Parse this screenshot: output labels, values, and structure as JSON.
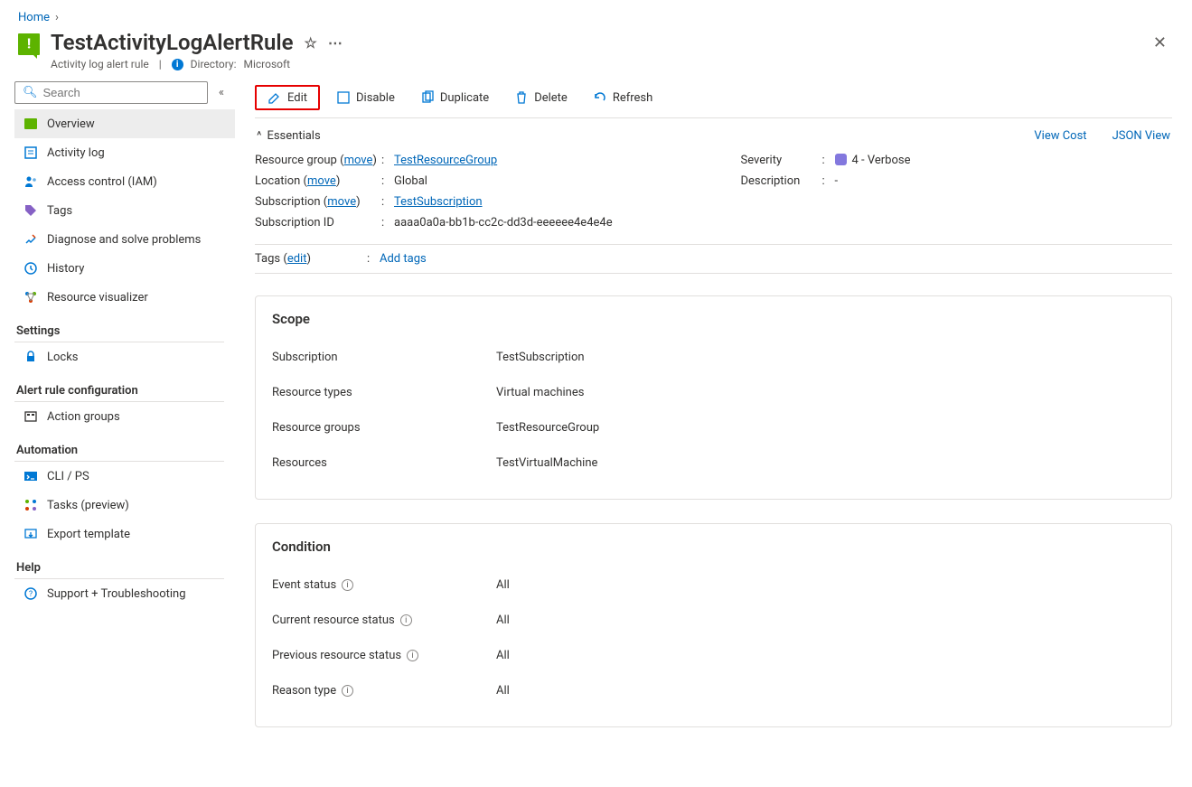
{
  "breadcrumb": {
    "home": "Home"
  },
  "header": {
    "title": "TestActivityLogAlertRule",
    "subtitle": "Activity log alert rule",
    "directory_label": "Directory:",
    "directory_value": "Microsoft"
  },
  "search": {
    "placeholder": "Search"
  },
  "sidebar": {
    "items": [
      {
        "label": "Overview"
      },
      {
        "label": "Activity log"
      },
      {
        "label": "Access control (IAM)"
      },
      {
        "label": "Tags"
      },
      {
        "label": "Diagnose and solve problems"
      },
      {
        "label": "History"
      },
      {
        "label": "Resource visualizer"
      }
    ],
    "section_settings": "Settings",
    "settings_items": [
      {
        "label": "Locks"
      }
    ],
    "section_rule": "Alert rule configuration",
    "rule_items": [
      {
        "label": "Action groups"
      }
    ],
    "section_automation": "Automation",
    "automation_items": [
      {
        "label": "CLI / PS"
      },
      {
        "label": "Tasks (preview)"
      },
      {
        "label": "Export template"
      }
    ],
    "section_help": "Help",
    "help_items": [
      {
        "label": "Support + Troubleshooting"
      }
    ]
  },
  "toolbar": {
    "edit": "Edit",
    "disable": "Disable",
    "duplicate": "Duplicate",
    "delete": "Delete",
    "refresh": "Refresh"
  },
  "essentials": {
    "toggle_label": "Essentials",
    "view_cost": "View Cost",
    "json_view": "JSON View",
    "left": {
      "resource_group_label": "Resource group",
      "resource_group_value": "TestResourceGroup",
      "location_label": "Location",
      "location_value": "Global",
      "subscription_label": "Subscription",
      "subscription_value": "TestSubscription",
      "subscription_id_label": "Subscription ID",
      "subscription_id_value": "aaaa0a0a-bb1b-cc2c-dd3d-eeeeee4e4e4e",
      "move": "move"
    },
    "right": {
      "severity_label": "Severity",
      "severity_value": "4 - Verbose",
      "description_label": "Description",
      "description_value": "-"
    }
  },
  "tags": {
    "label": "Tags",
    "edit": "edit",
    "add": "Add tags"
  },
  "scope": {
    "title": "Scope",
    "rows": {
      "subscription_l": "Subscription",
      "subscription_v": "TestSubscription",
      "resource_types_l": "Resource types",
      "resource_types_v": "Virtual machines",
      "resource_groups_l": "Resource groups",
      "resource_groups_v": "TestResourceGroup",
      "resources_l": "Resources",
      "resources_v": "TestVirtualMachine"
    }
  },
  "condition": {
    "title": "Condition",
    "rows": {
      "event_status_l": "Event status",
      "event_status_v": "All",
      "current_l": "Current resource status",
      "current_v": "All",
      "previous_l": "Previous resource status",
      "previous_v": "All",
      "reason_l": "Reason type",
      "reason_v": "All"
    }
  }
}
